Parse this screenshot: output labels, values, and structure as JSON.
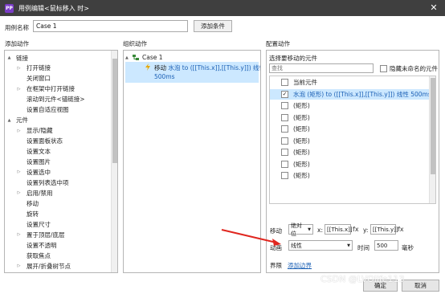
{
  "window": {
    "title": "用例编辑<鼠标移入 时>",
    "app_icon": "PP",
    "close_glyph": "✕"
  },
  "case_name": {
    "label": "用例名称",
    "value": "Case 1",
    "add_condition": "添加条件"
  },
  "panels": {
    "add_action": "添加动作",
    "organize_action": "组织动作",
    "configure_action": "配置动作"
  },
  "tree": [
    {
      "label": "链接",
      "level": 0,
      "expand": "▲"
    },
    {
      "label": "打开链接",
      "level": 1,
      "expand": "▷"
    },
    {
      "label": "关闭窗口",
      "level": 1,
      "expand": ""
    },
    {
      "label": "在框架中打开链接",
      "level": 1,
      "expand": "▷"
    },
    {
      "label": "滚动到元件<锚链接>",
      "level": 1,
      "expand": ""
    },
    {
      "label": "设置自适应视图",
      "level": 1,
      "expand": ""
    },
    {
      "label": "元件",
      "level": 0,
      "expand": "▲"
    },
    {
      "label": "显示/隐藏",
      "level": 1,
      "expand": "▷"
    },
    {
      "label": "设置面板状态",
      "level": 1,
      "expand": ""
    },
    {
      "label": "设置文本",
      "level": 1,
      "expand": ""
    },
    {
      "label": "设置图片",
      "level": 1,
      "expand": ""
    },
    {
      "label": "设置选中",
      "level": 1,
      "expand": "▷"
    },
    {
      "label": "设置列表选中项",
      "level": 1,
      "expand": ""
    },
    {
      "label": "启用/禁用",
      "level": 1,
      "expand": "▷"
    },
    {
      "label": "移动",
      "level": 1,
      "expand": ""
    },
    {
      "label": "旋转",
      "level": 1,
      "expand": ""
    },
    {
      "label": "设置尺寸",
      "level": 1,
      "expand": ""
    },
    {
      "label": "置于顶层/底层",
      "level": 1,
      "expand": "▷"
    },
    {
      "label": "设置不透明",
      "level": 1,
      "expand": ""
    },
    {
      "label": "获取焦点",
      "level": 1,
      "expand": ""
    },
    {
      "label": "展开/折叠树节点",
      "level": 1,
      "expand": "▷"
    }
  ],
  "organize": {
    "case_label": "Case 1",
    "action_name": "移动",
    "action_detail": "水泡 to ([[This.x]],[[This.y]]) 线性",
    "action_detail2": "500ms"
  },
  "configure": {
    "select_label": "选择要移动的元件",
    "search_placeholder": "查找",
    "hide_unnamed": "隐藏未命名的元件",
    "targets": [
      {
        "label": "当前元件",
        "checked": false
      },
      {
        "label": "水泡 (矩形) to ([[This.x]],[[This.y]]) 线性 500ms",
        "checked": true
      },
      {
        "label": "(矩形)",
        "checked": false
      },
      {
        "label": "(矩形)",
        "checked": false
      },
      {
        "label": "(矩形)",
        "checked": false
      },
      {
        "label": "(矩形)",
        "checked": false
      },
      {
        "label": "(矩形)",
        "checked": false
      },
      {
        "label": "(矩形)",
        "checked": false
      },
      {
        "label": "(矩形)",
        "checked": false
      }
    ],
    "move_label": "移动",
    "move_mode": "绝对位",
    "x_label": "x:",
    "x_value": "[[This.x]]",
    "y_label": "y:",
    "y_value": "[[This.y]]",
    "fx": "fx",
    "anim_label": "动画",
    "anim_value": "线性",
    "time_label": "时间",
    "time_value": "500",
    "ms_label": "毫秒",
    "bounds_label": "界限",
    "bounds_link": "添加边界"
  },
  "buttons": {
    "ok": "确定",
    "cancel": "取消"
  },
  "watermark": "CSDN @LVOlife113",
  "colors": {
    "titlebar": "#3f3f3f",
    "selection": "#cce8ff",
    "link": "#1a5fb4",
    "arrow": "#e0261f",
    "action_blue": "#1a5fb4"
  }
}
